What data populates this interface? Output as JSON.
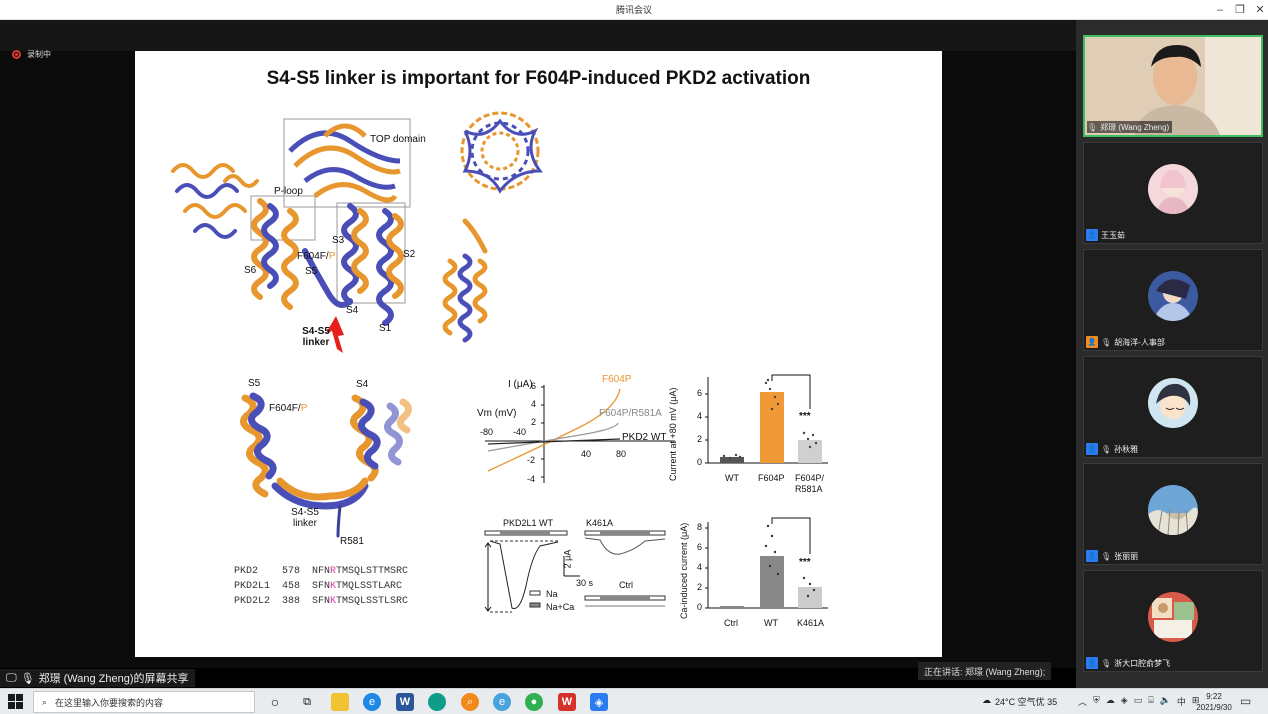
{
  "window": {
    "title": "腾讯会议"
  },
  "recording": {
    "label": "录制中"
  },
  "slide": {
    "title": "S4-S5 linker is important for F604P-induced PKD2 activation",
    "structure_labels": {
      "top_domain": "TOP domain",
      "p_loop": "P-loop",
      "s1": "S1",
      "s2": "S2",
      "s3": "S3",
      "s4": "S4",
      "s5": "S5",
      "s6": "S6",
      "f604": "F604F/",
      "f604_p": "P",
      "linker_1": "S4-S5",
      "linker_2": "linker"
    },
    "zoom_labels": {
      "s5": "S5",
      "s4": "S4",
      "f604": "F604F/",
      "f604_p": "P",
      "linker_1": "S4-S5",
      "linker_2": "linker",
      "r581": "R581"
    },
    "sequences": [
      {
        "name": "PKD2",
        "num": "578",
        "pre": "NFN",
        "hl": "R",
        "post": "TMSQLSTTMSRC"
      },
      {
        "name": "PKD2L1",
        "num": "458",
        "pre": "SFN",
        "hl": "K",
        "post": "TMQLSSTLARC"
      },
      {
        "name": "PKD2L2",
        "num": "388",
        "pre": "SFN",
        "hl": "K",
        "post": "TMSQLSSTLSRC"
      }
    ],
    "iv_plot": {
      "ylabel": "I (μA)",
      "xlabel": "Vm (mV)",
      "yticks": [
        "6",
        "4",
        "2",
        "-2",
        "-4"
      ],
      "xticks_neg": [
        "-80",
        "-40"
      ],
      "xticks_pos": [
        "40",
        "80"
      ],
      "traces": [
        "F604P",
        "F604P/R581A",
        "PKD2 WT"
      ]
    },
    "bar1": {
      "ylabel": "Current at +80 mV (μA)",
      "yticks": [
        "0",
        "2",
        "4",
        "6"
      ],
      "categories": [
        "WT",
        "F604P",
        "F604P/",
        "R581A"
      ],
      "significance": "***"
    },
    "traces": {
      "title1": "PKD2L1 WT",
      "title2": "K461A",
      "scale_y": "2 μA",
      "scale_x": "30 s",
      "legend_na": "Na",
      "legend_naca": "Na+Ca",
      "ctrl": "Ctrl"
    },
    "bar2": {
      "ylabel": "Ca-induced current (μA)",
      "yticks": [
        "0",
        "2",
        "4",
        "6",
        "8"
      ],
      "categories": [
        "Ctrl",
        "WT",
        "K461A"
      ],
      "significance": "***"
    }
  },
  "captions": {
    "share": "郑璟 (Wang Zheng)的屏幕共享",
    "speaking": "正在讲话: 郑璟 (Wang Zheng);"
  },
  "participants": [
    {
      "name": "郑璟 (Wang Zheng)",
      "active": true
    },
    {
      "name": "王玉茹",
      "active": false
    },
    {
      "name": "胡海洋-人事部",
      "active": false
    },
    {
      "name": "孙秋雅",
      "active": false
    },
    {
      "name": "张丽丽",
      "active": false
    },
    {
      "name": "浙大口腔俞梦飞",
      "active": false
    }
  ],
  "taskbar": {
    "search_placeholder": "在这里输入你要搜索的内容",
    "weather": "24°C 空气优 35",
    "ime": "中",
    "time": "9:22",
    "date": "2021/9/30"
  }
}
